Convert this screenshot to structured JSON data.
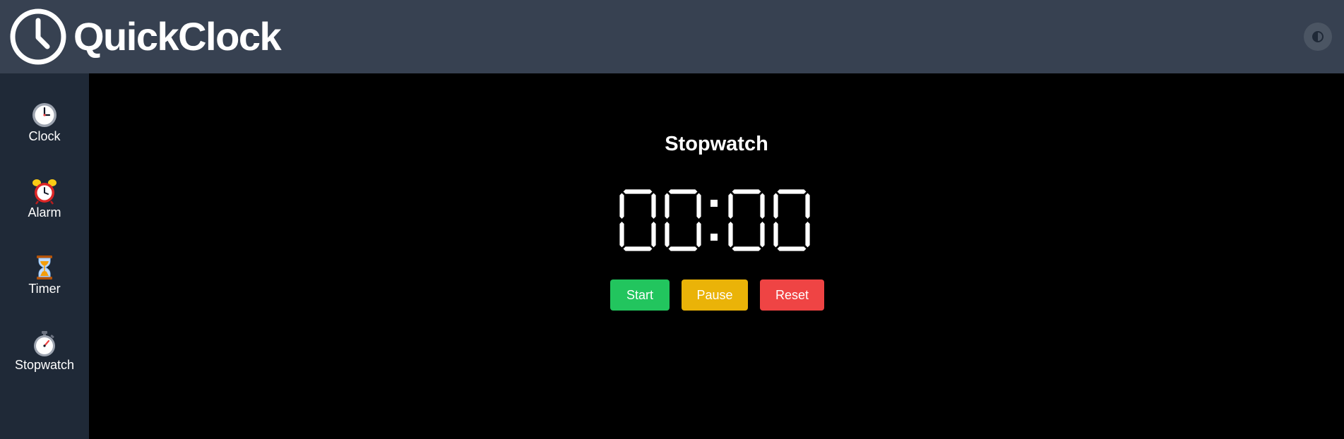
{
  "header": {
    "app_name": "QuickClock",
    "logo_icon": "clock-icon",
    "theme_toggle_icon": "contrast-icon"
  },
  "sidebar": {
    "items": [
      {
        "label": "Clock",
        "icon": "clock-icon"
      },
      {
        "label": "Alarm",
        "icon": "alarm-clock-icon"
      },
      {
        "label": "Timer",
        "icon": "hourglass-icon"
      },
      {
        "label": "Stopwatch",
        "icon": "stopwatch-icon"
      }
    ]
  },
  "main": {
    "title": "Stopwatch",
    "display": {
      "minutes": "00",
      "seconds": "00"
    },
    "buttons": {
      "start": "Start",
      "pause": "Pause",
      "reset": "Reset"
    }
  },
  "colors": {
    "header_bg": "#374151",
    "sidebar_bg": "#1f2937",
    "main_bg": "#000000",
    "start": "#22c55e",
    "pause": "#eab308",
    "reset": "#ef4444"
  }
}
